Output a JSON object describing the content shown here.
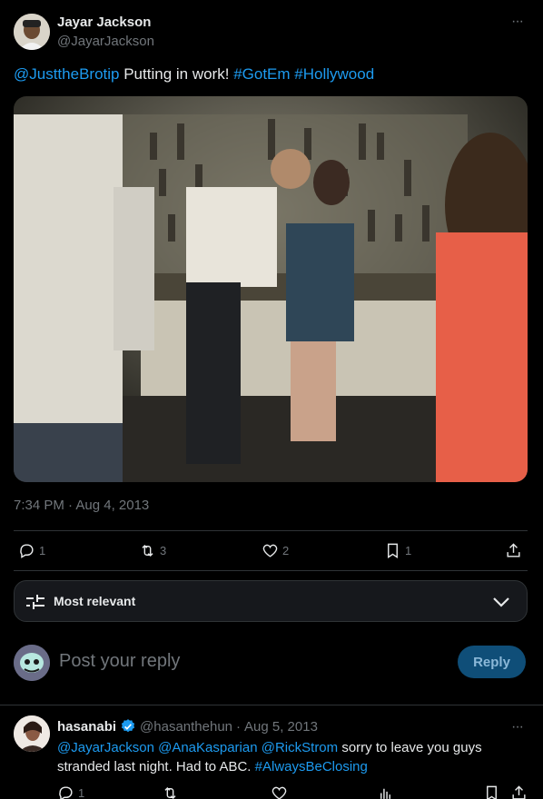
{
  "tweet": {
    "author_name": "Jayar Jackson",
    "author_handle": "@JayarJackson",
    "text_mention": "@JusttheBrotip",
    "text_body": "Putting in work!",
    "hashtag_1": "#GotEm",
    "hashtag_2": "#Hollywood",
    "timestamp": "7:34 PM · Aug 4, 2013",
    "replies": "1",
    "retweets": "3",
    "likes": "2",
    "bookmarks": "1",
    "more": "···"
  },
  "sort": {
    "label": "Most relevant"
  },
  "composer": {
    "placeholder": "Post your reply",
    "reply_label": "Reply"
  },
  "reply": {
    "author_name": "hasanabi",
    "author_handle": "@hasanthehun",
    "separator": "·",
    "date": "Aug 5, 2013",
    "mention_1": "@JayarJackson",
    "mention_2": "@AnaKasparian",
    "mention_3": "@RickStrom",
    "text_1": "sorry to leave you guys",
    "text_2": "stranded last night. Had to ABC.",
    "hashtag": "#AlwaysBeClosing",
    "replies": "1",
    "more": "···"
  },
  "colors": {
    "accent": "#1d9bf0",
    "background": "#000000",
    "muted": "#71767b"
  }
}
